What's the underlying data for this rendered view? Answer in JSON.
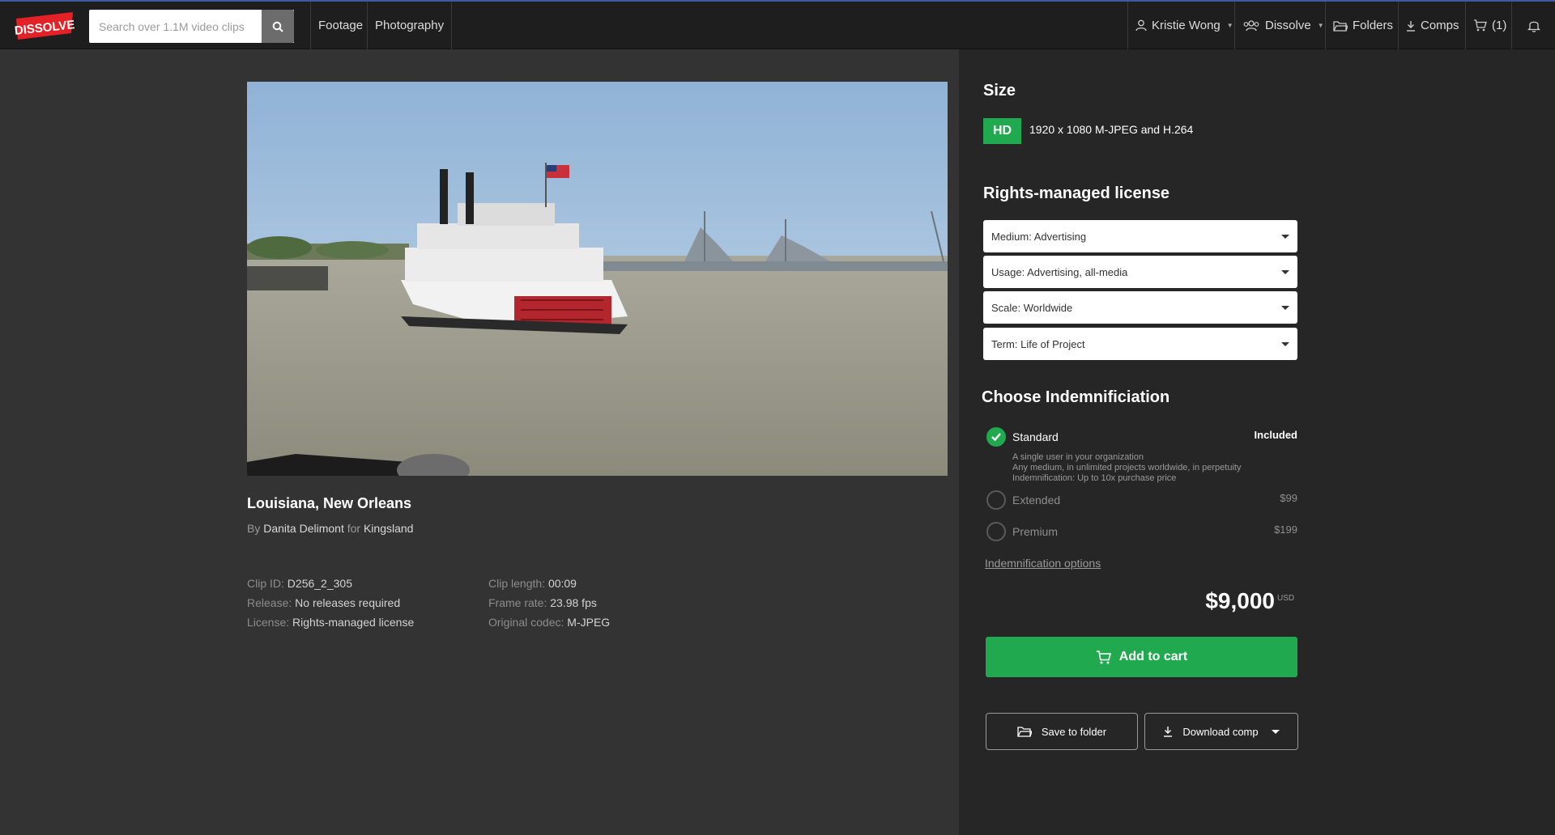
{
  "header": {
    "logo_text": "DISSOLVE",
    "search_placeholder": "Search over 1.1M video clips",
    "nav": [
      "Footage",
      "Photography"
    ],
    "user_name": "Kristie Wong",
    "team_name": "Dissolve",
    "folders_label": "Folders",
    "comps_label": "Comps",
    "cart_count": "(1)"
  },
  "clip": {
    "title": "Louisiana, New Orleans",
    "by_prefix": "By",
    "author": "Danita Delimont",
    "for_word": "for",
    "collection": "Kingsland",
    "meta_left": [
      {
        "label": "Clip ID:",
        "value": "D256_2_305"
      },
      {
        "label": "Release:",
        "value": "No releases required"
      },
      {
        "label": "License:",
        "value": "Rights-managed license"
      }
    ],
    "meta_right": [
      {
        "label": "Clip length:",
        "value": "00:09"
      },
      {
        "label": "Frame rate:",
        "value": "23.98 fps"
      },
      {
        "label": "Original codec:",
        "value": "M-JPEG"
      }
    ]
  },
  "size": {
    "heading": "Size",
    "badge": "HD",
    "spec": "1920 x 1080  M-JPEG and H.264"
  },
  "license": {
    "heading": "Rights-managed license",
    "selects": [
      "Medium: Advertising",
      "Usage: Advertising, all-media",
      "Scale: Worldwide",
      "Term: Life of Project"
    ]
  },
  "indemnification": {
    "heading": "Choose Indemnificiation",
    "standard_label": "Standard",
    "standard_price": "Included",
    "standard_desc": [
      "A single user in your organization",
      "Any medium, in unlimited projects worldwide, in perpetuity",
      "Indemnification: Up to 10x purchase price"
    ],
    "extended_label": "Extended",
    "extended_price": "$99",
    "premium_label": "Premium",
    "premium_price": "$199",
    "options_link": "Indemnification options"
  },
  "checkout": {
    "price": "$9,000",
    "currency": "USD",
    "add_to_cart": "Add to cart",
    "save_to_folder": "Save to folder",
    "download_comp": "Download comp"
  },
  "colors": {
    "accent": "#21a94f",
    "logo_red": "#e32127"
  }
}
